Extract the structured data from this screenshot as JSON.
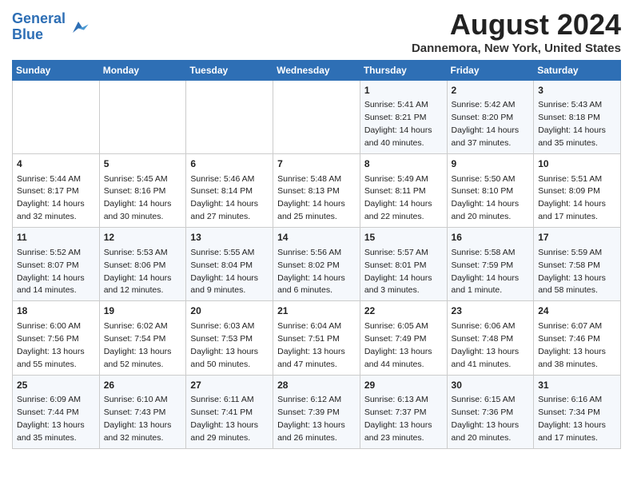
{
  "header": {
    "logo_line1": "General",
    "logo_line2": "Blue",
    "month": "August 2024",
    "location": "Dannemora, New York, United States"
  },
  "weekdays": [
    "Sunday",
    "Monday",
    "Tuesday",
    "Wednesday",
    "Thursday",
    "Friday",
    "Saturday"
  ],
  "weeks": [
    [
      {
        "day": "",
        "info": ""
      },
      {
        "day": "",
        "info": ""
      },
      {
        "day": "",
        "info": ""
      },
      {
        "day": "",
        "info": ""
      },
      {
        "day": "1",
        "info": "Sunrise: 5:41 AM\nSunset: 8:21 PM\nDaylight: 14 hours\nand 40 minutes."
      },
      {
        "day": "2",
        "info": "Sunrise: 5:42 AM\nSunset: 8:20 PM\nDaylight: 14 hours\nand 37 minutes."
      },
      {
        "day": "3",
        "info": "Sunrise: 5:43 AM\nSunset: 8:18 PM\nDaylight: 14 hours\nand 35 minutes."
      }
    ],
    [
      {
        "day": "4",
        "info": "Sunrise: 5:44 AM\nSunset: 8:17 PM\nDaylight: 14 hours\nand 32 minutes."
      },
      {
        "day": "5",
        "info": "Sunrise: 5:45 AM\nSunset: 8:16 PM\nDaylight: 14 hours\nand 30 minutes."
      },
      {
        "day": "6",
        "info": "Sunrise: 5:46 AM\nSunset: 8:14 PM\nDaylight: 14 hours\nand 27 minutes."
      },
      {
        "day": "7",
        "info": "Sunrise: 5:48 AM\nSunset: 8:13 PM\nDaylight: 14 hours\nand 25 minutes."
      },
      {
        "day": "8",
        "info": "Sunrise: 5:49 AM\nSunset: 8:11 PM\nDaylight: 14 hours\nand 22 minutes."
      },
      {
        "day": "9",
        "info": "Sunrise: 5:50 AM\nSunset: 8:10 PM\nDaylight: 14 hours\nand 20 minutes."
      },
      {
        "day": "10",
        "info": "Sunrise: 5:51 AM\nSunset: 8:09 PM\nDaylight: 14 hours\nand 17 minutes."
      }
    ],
    [
      {
        "day": "11",
        "info": "Sunrise: 5:52 AM\nSunset: 8:07 PM\nDaylight: 14 hours\nand 14 minutes."
      },
      {
        "day": "12",
        "info": "Sunrise: 5:53 AM\nSunset: 8:06 PM\nDaylight: 14 hours\nand 12 minutes."
      },
      {
        "day": "13",
        "info": "Sunrise: 5:55 AM\nSunset: 8:04 PM\nDaylight: 14 hours\nand 9 minutes."
      },
      {
        "day": "14",
        "info": "Sunrise: 5:56 AM\nSunset: 8:02 PM\nDaylight: 14 hours\nand 6 minutes."
      },
      {
        "day": "15",
        "info": "Sunrise: 5:57 AM\nSunset: 8:01 PM\nDaylight: 14 hours\nand 3 minutes."
      },
      {
        "day": "16",
        "info": "Sunrise: 5:58 AM\nSunset: 7:59 PM\nDaylight: 14 hours\nand 1 minute."
      },
      {
        "day": "17",
        "info": "Sunrise: 5:59 AM\nSunset: 7:58 PM\nDaylight: 13 hours\nand 58 minutes."
      }
    ],
    [
      {
        "day": "18",
        "info": "Sunrise: 6:00 AM\nSunset: 7:56 PM\nDaylight: 13 hours\nand 55 minutes."
      },
      {
        "day": "19",
        "info": "Sunrise: 6:02 AM\nSunset: 7:54 PM\nDaylight: 13 hours\nand 52 minutes."
      },
      {
        "day": "20",
        "info": "Sunrise: 6:03 AM\nSunset: 7:53 PM\nDaylight: 13 hours\nand 50 minutes."
      },
      {
        "day": "21",
        "info": "Sunrise: 6:04 AM\nSunset: 7:51 PM\nDaylight: 13 hours\nand 47 minutes."
      },
      {
        "day": "22",
        "info": "Sunrise: 6:05 AM\nSunset: 7:49 PM\nDaylight: 13 hours\nand 44 minutes."
      },
      {
        "day": "23",
        "info": "Sunrise: 6:06 AM\nSunset: 7:48 PM\nDaylight: 13 hours\nand 41 minutes."
      },
      {
        "day": "24",
        "info": "Sunrise: 6:07 AM\nSunset: 7:46 PM\nDaylight: 13 hours\nand 38 minutes."
      }
    ],
    [
      {
        "day": "25",
        "info": "Sunrise: 6:09 AM\nSunset: 7:44 PM\nDaylight: 13 hours\nand 35 minutes."
      },
      {
        "day": "26",
        "info": "Sunrise: 6:10 AM\nSunset: 7:43 PM\nDaylight: 13 hours\nand 32 minutes."
      },
      {
        "day": "27",
        "info": "Sunrise: 6:11 AM\nSunset: 7:41 PM\nDaylight: 13 hours\nand 29 minutes."
      },
      {
        "day": "28",
        "info": "Sunrise: 6:12 AM\nSunset: 7:39 PM\nDaylight: 13 hours\nand 26 minutes."
      },
      {
        "day": "29",
        "info": "Sunrise: 6:13 AM\nSunset: 7:37 PM\nDaylight: 13 hours\nand 23 minutes."
      },
      {
        "day": "30",
        "info": "Sunrise: 6:15 AM\nSunset: 7:36 PM\nDaylight: 13 hours\nand 20 minutes."
      },
      {
        "day": "31",
        "info": "Sunrise: 6:16 AM\nSunset: 7:34 PM\nDaylight: 13 hours\nand 17 minutes."
      }
    ]
  ]
}
